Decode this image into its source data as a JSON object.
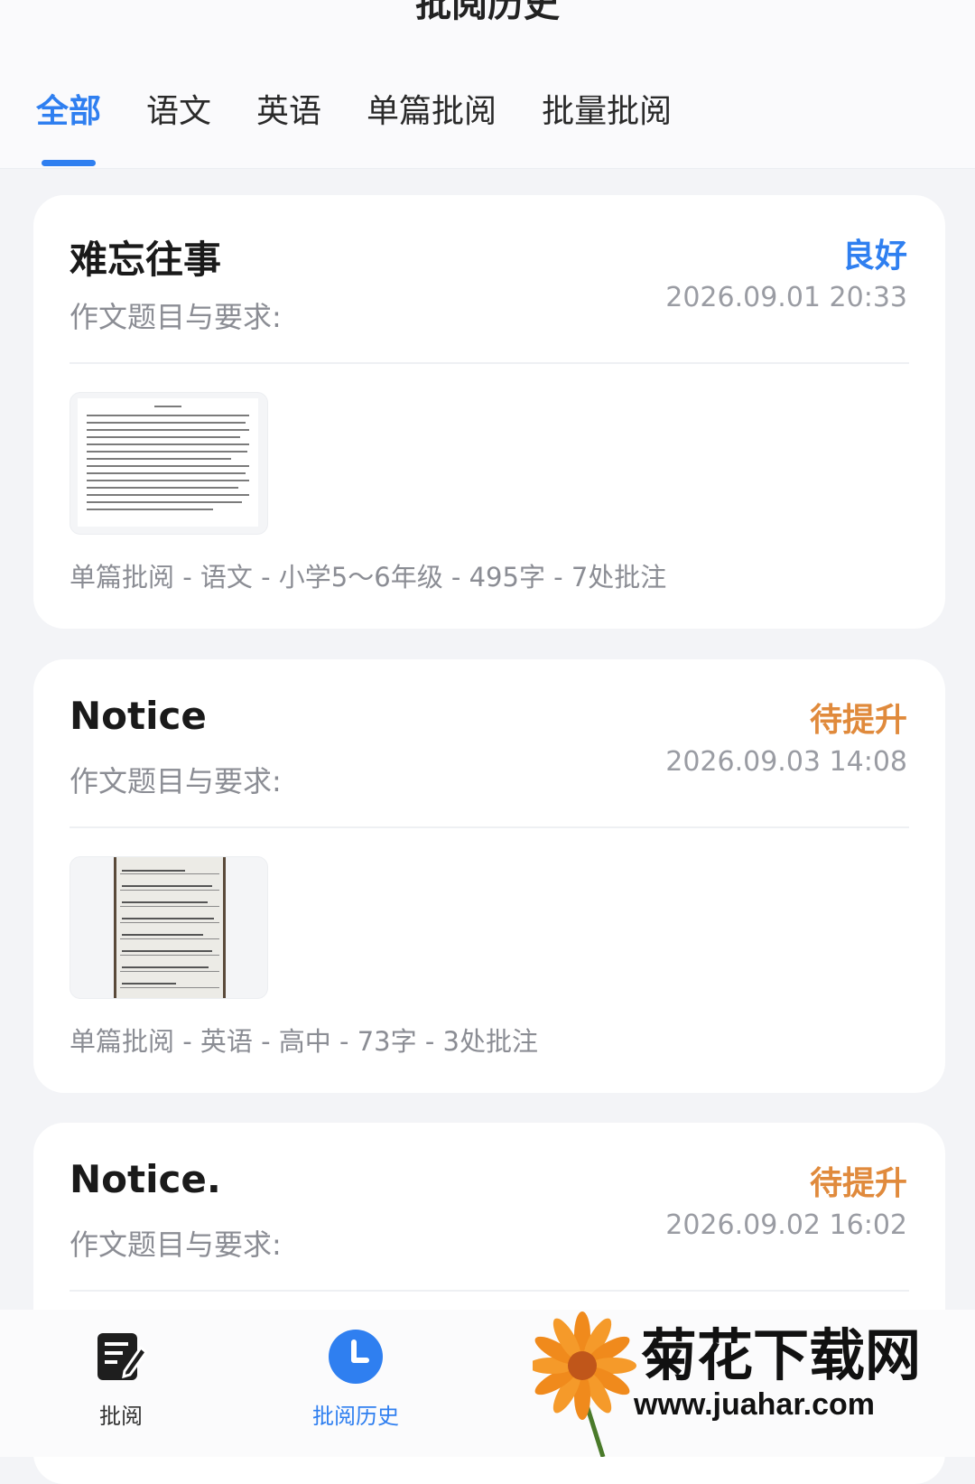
{
  "header": {
    "title": "批阅历史",
    "tabs": [
      {
        "label": "全部",
        "active": true
      },
      {
        "label": "语文",
        "active": false
      },
      {
        "label": "英语",
        "active": false
      },
      {
        "label": "单篇批阅",
        "active": false
      },
      {
        "label": "批量批阅",
        "active": false
      }
    ]
  },
  "colors": {
    "accent": "#2f7ff0",
    "good": "#2f7ff0",
    "improve": "#e08a3c"
  },
  "cards": [
    {
      "title": "难忘往事",
      "grade": "良好",
      "date": "2026.09.01 20:33",
      "prompt": "作文题目与要求:",
      "meta": "单篇批阅 - 语文 - 小学5～6年级 - 495字 - 7处批注"
    },
    {
      "title": "Notice",
      "grade": "待提升",
      "date": "2026.09.03 14:08",
      "prompt": "作文题目与要求:",
      "meta": "单篇批阅 - 英语 - 高中 - 73字 - 3处批注"
    },
    {
      "title": "Notice.",
      "grade": "待提升",
      "date": "2026.09.02 16:02",
      "prompt": "作文题目与要求:"
    }
  ],
  "nav": {
    "items": [
      {
        "label": "批阅",
        "icon": "edit-document-icon"
      },
      {
        "label": "批阅历史",
        "icon": "clock-icon"
      }
    ]
  },
  "watermark": {
    "title": "菊花下载网",
    "url": "www.juahar.com"
  }
}
